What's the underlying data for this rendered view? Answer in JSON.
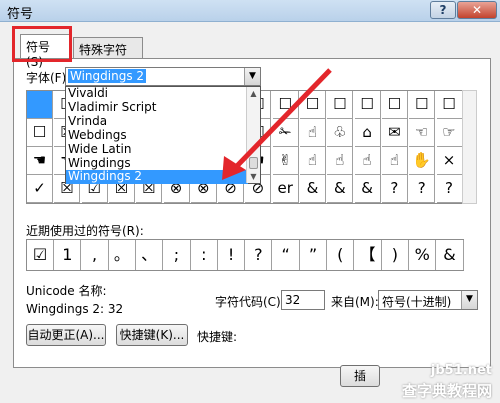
{
  "window": {
    "title": "符号",
    "help": "?",
    "close": "✕"
  },
  "tabs": [
    {
      "label": "符号(S)"
    },
    {
      "label": "特殊字符(P)"
    }
  ],
  "font": {
    "label": "字体(F):",
    "value": "Wingdings 2",
    "options": [
      "Vivaldi",
      "Vladimir Script",
      "Vrinda",
      "Webdings",
      "Wide Latin",
      "Wingdings",
      "Wingdings 2"
    ],
    "selected_index": 6
  },
  "grid": {
    "rows": [
      [
        "",
        "☐",
        "☐",
        "☐",
        "☐",
        "☐",
        "☐",
        "☐",
        "☐",
        "☐",
        "☐",
        "☐",
        "☐",
        "☐",
        "☐",
        "☐"
      ],
      [
        "☐",
        "☒",
        "☑",
        "☑",
        "☑",
        "☑",
        "☑",
        "☐",
        "☐",
        "✁",
        "☝",
        "♧",
        "⌂",
        "✉",
        "☜",
        "☞"
      ],
      [
        "☚",
        "☚",
        "☚",
        "☚",
        "☚",
        "☚",
        "☚",
        "☚",
        "☚",
        "✌",
        "☝",
        "☝",
        "☝",
        "☝",
        "✋",
        "×"
      ],
      [
        "✓",
        "☒",
        "☑",
        "☒",
        "☒",
        "⊗",
        "⊗",
        "⊘",
        "⊘",
        "er",
        "&",
        "&",
        "&",
        "?",
        "?",
        "?"
      ]
    ]
  },
  "recent": {
    "label": "近期使用过的符号(R):",
    "symbols": [
      "☑",
      "1",
      ",",
      "。",
      "、",
      ";",
      ":",
      "!",
      "?",
      "“",
      "”",
      "(",
      "【",
      ")",
      "%",
      "&"
    ]
  },
  "unicode": {
    "name_label": "Unicode 名称:",
    "name_value": "Wingdings 2: 32"
  },
  "code": {
    "label": "字符代码(C):",
    "value": "32"
  },
  "from": {
    "label": "来自(M):",
    "value": "符号(十进制)"
  },
  "buttons": {
    "autocorrect": "自动更正(A)...",
    "shortcut_key": "快捷键(K)...",
    "shortcut_label": "快捷键:",
    "insert": "插"
  },
  "watermark": {
    "site": "jb51.net",
    "text": "查字典教程网"
  }
}
